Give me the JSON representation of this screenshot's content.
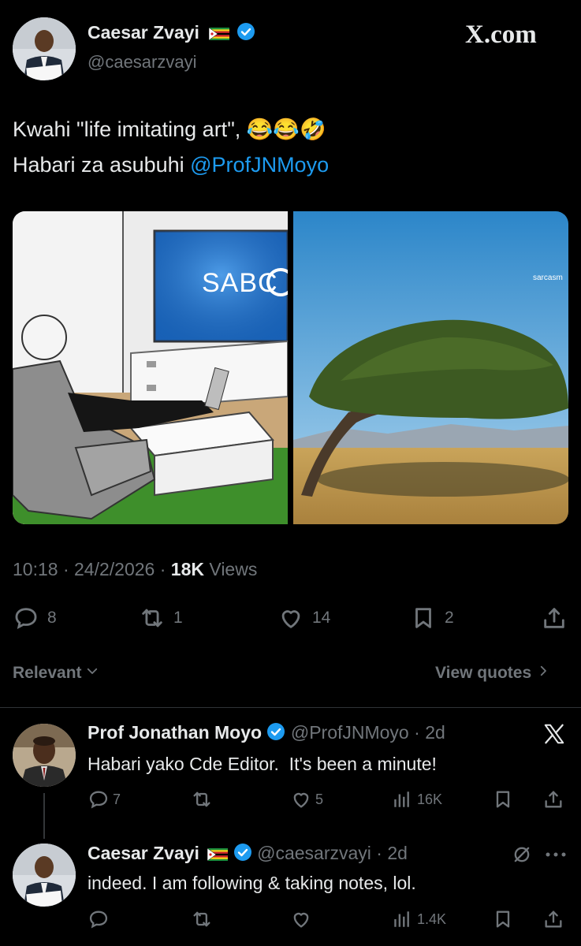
{
  "brand": {
    "watermark": "X.com",
    "x_icon": "x-logo-icon"
  },
  "main_post": {
    "author_name": "Caesar Zvayi",
    "author_handle": "@caesarzvayi",
    "text_line1": "Kwahi \"life imitating art\", 😂😂🤣",
    "text_line2_prefix": "Habari za asubuhi ",
    "text_line2_mention": "@ProfJNMoyo",
    "image_left_text": "SABC",
    "image_right_text": "sarcasm",
    "time": "10:18",
    "date": "24/2/2026",
    "views_count": "18K",
    "views_label": "Views",
    "replies": "8",
    "reposts": "1",
    "likes": "14",
    "bookmarks": "2"
  },
  "filter_bar": {
    "sort_label": "Relevant",
    "quotes_label": "View quotes"
  },
  "replies": [
    {
      "author_name": "Prof Jonathan Moyo",
      "author_handle": "@ProfJNMoyo",
      "age": "2d",
      "text": "Habari yako Cde Editor.  It's been a minute!",
      "replies": "7",
      "reposts": "",
      "likes": "5",
      "views": "16K"
    },
    {
      "author_name": "Caesar Zvayi",
      "author_handle": "@caesarzvayi",
      "age": "2d",
      "text": "indeed. I am following & taking notes, lol.",
      "replies": "",
      "reposts": "",
      "likes": "",
      "views": "1.4K"
    }
  ],
  "colors": {
    "background": "#000000",
    "text": "#e7e9ea",
    "muted": "#71767b",
    "link": "#1d9bf0",
    "divider": "#2f3336"
  }
}
